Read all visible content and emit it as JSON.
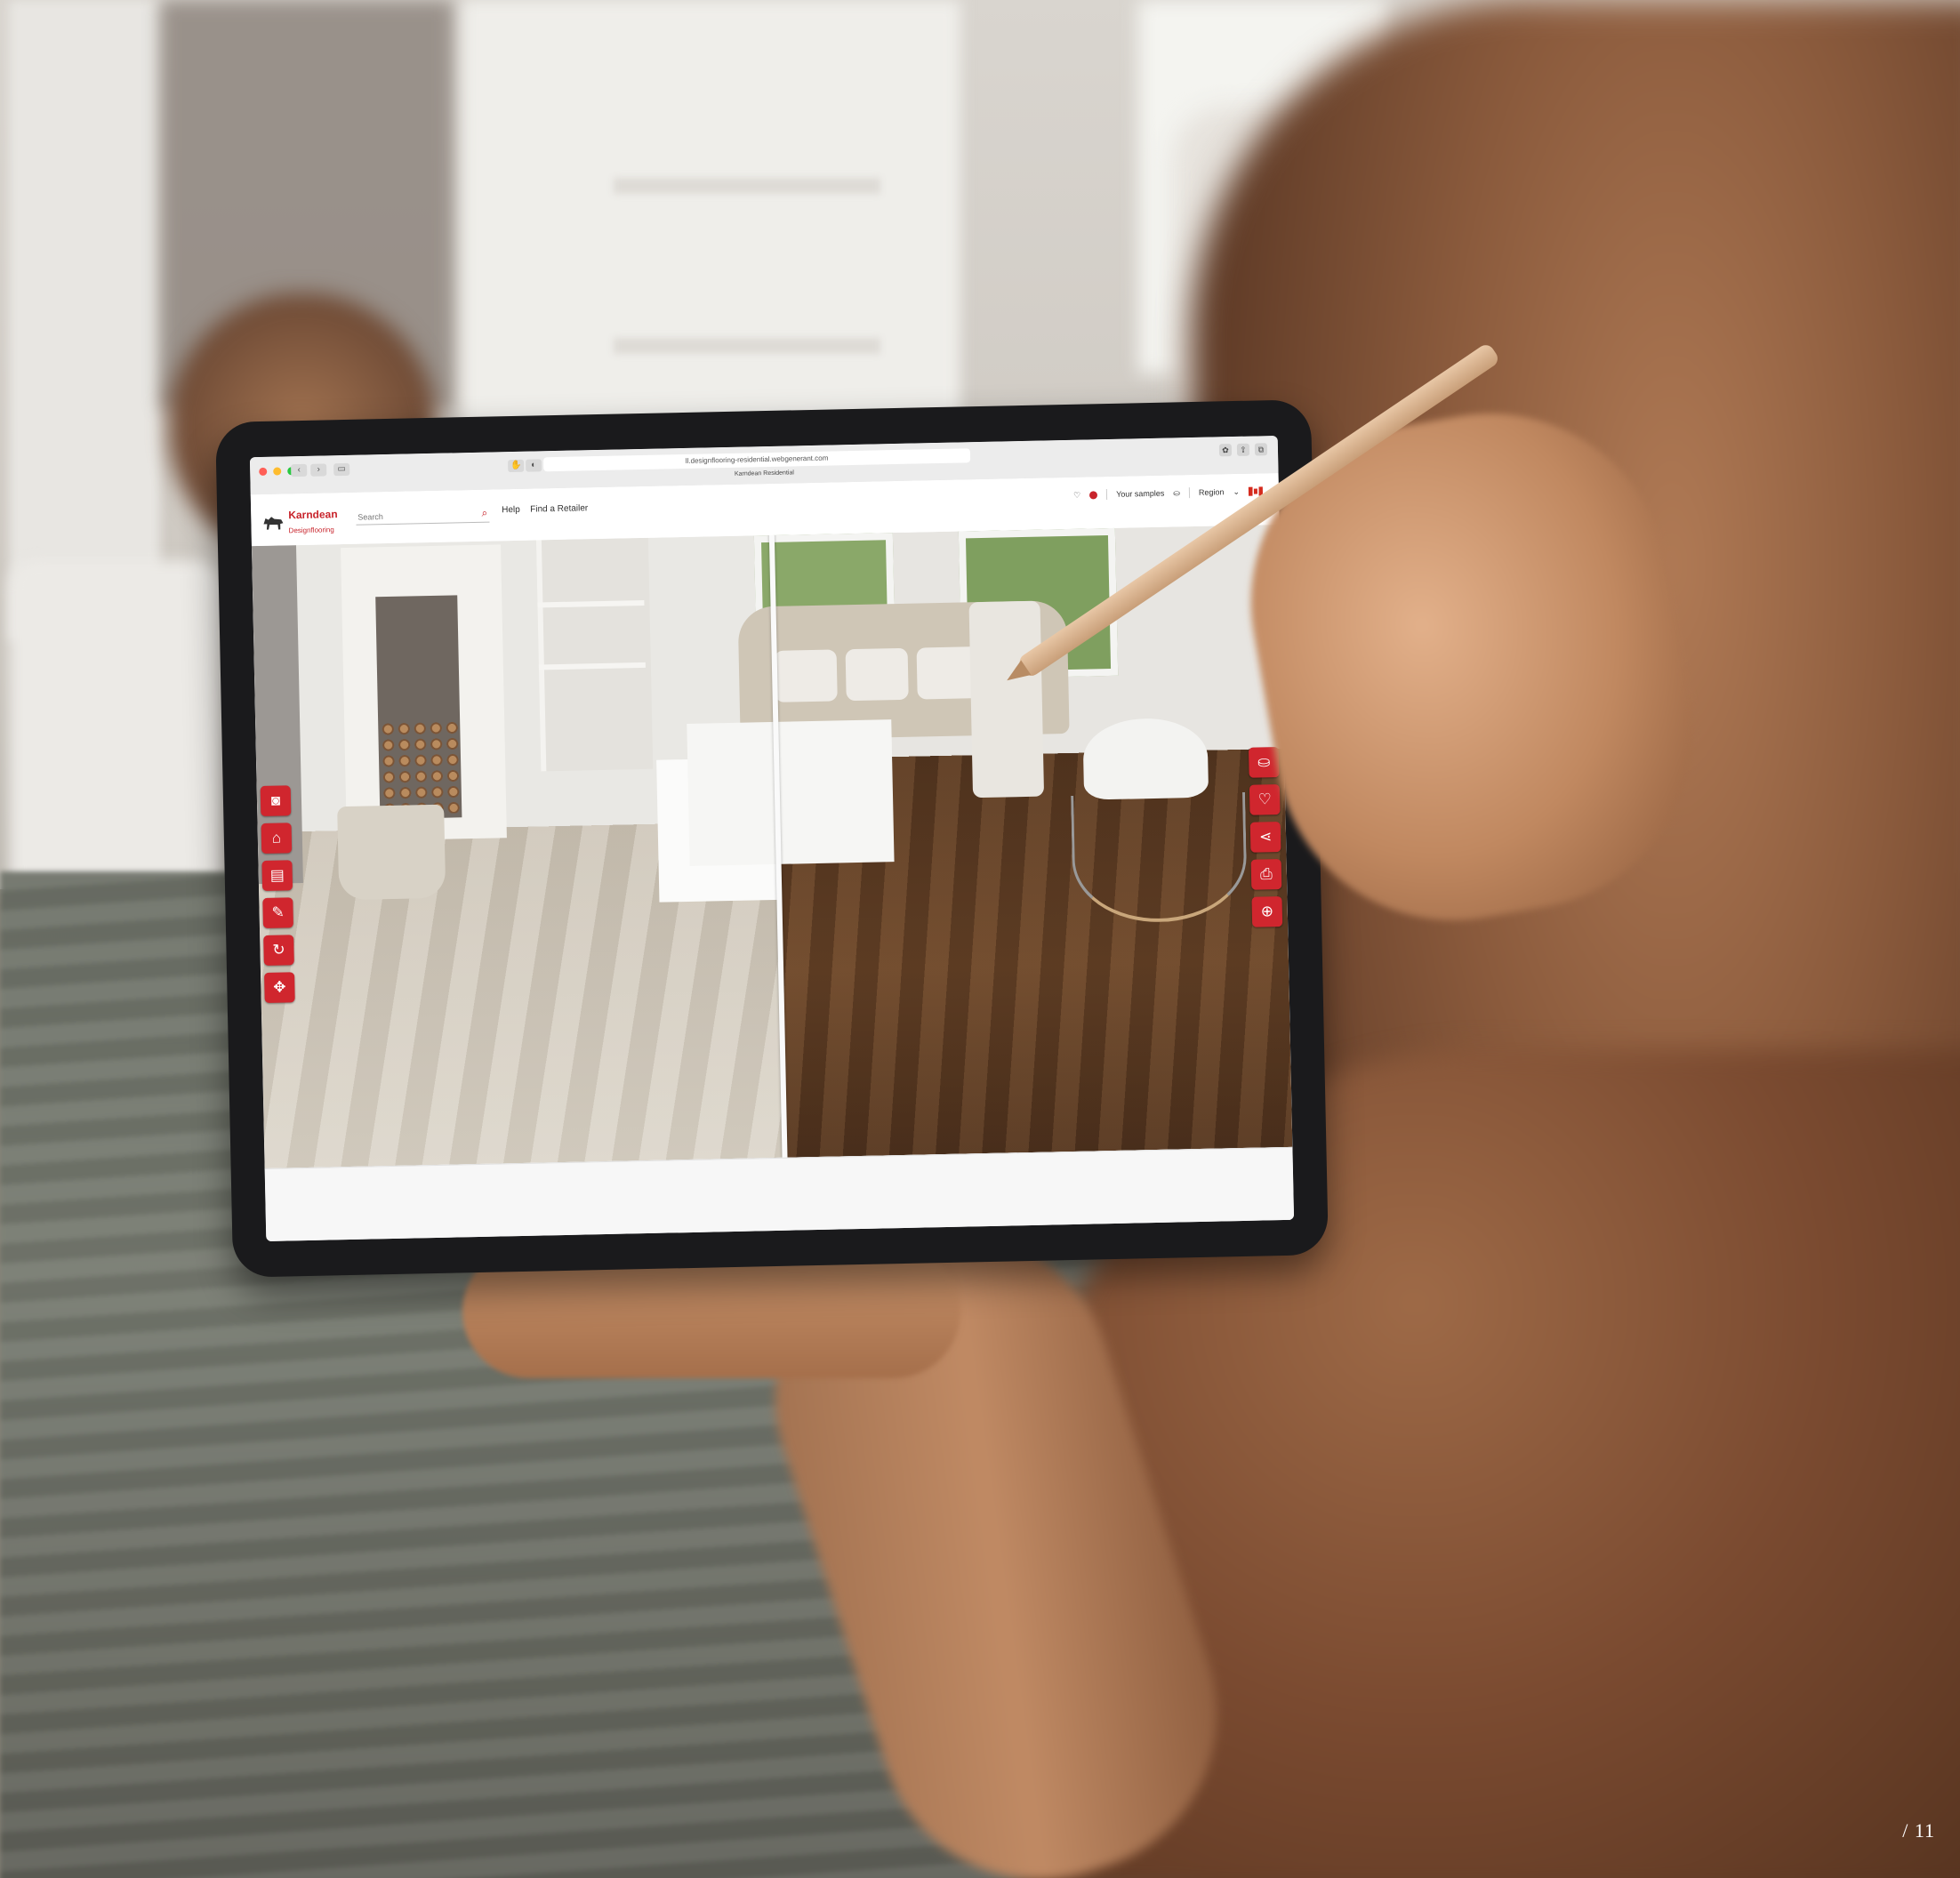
{
  "browser": {
    "url": "ll.designflooring-residential.webgenerant.com",
    "tab_title": "Karndean Residential"
  },
  "header": {
    "brand": "Karndean",
    "brand_sub": "Designflooring",
    "search_placeholder": "Search",
    "links": [
      "Help",
      "Find a Retailer"
    ],
    "samples_label": "Your samples",
    "region_label": "Region",
    "accent_color": "#c8242c"
  },
  "tools": {
    "left": [
      "camera-icon",
      "floor-icon",
      "layout-icon",
      "brush-icon",
      "rotate-icon",
      "move-icon"
    ],
    "right": [
      "basket-icon",
      "heart-icon",
      "share-icon",
      "print-icon",
      "zoom-icon"
    ]
  },
  "page_number": "/ 11"
}
